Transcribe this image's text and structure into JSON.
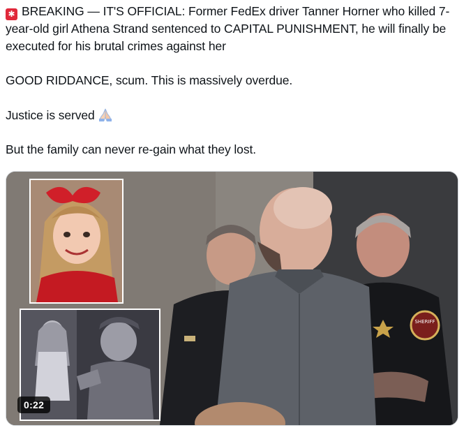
{
  "post": {
    "headline_icon": "siren-emoji",
    "headline": "BREAKING — IT'S OFFICIAL: Former FedEx driver Tanner Horner who killed 7-year-old girl Athena Strand sentenced to CAPITAL PUNISHMENT, he will finally be executed for his brutal crimes against her",
    "line2": "GOOD RIDDANCE, scum. This is massively overdue.",
    "line3": "Justice is served",
    "line3_icon": "folded-hands-emoji",
    "line4": "But the family can never re-gain what they lost."
  },
  "media": {
    "duration": "0:22",
    "badge_text": "SHERIFF"
  },
  "colors": {
    "text": "#0f1419",
    "siren": "#e0283a",
    "timer_bg": "#000000"
  }
}
